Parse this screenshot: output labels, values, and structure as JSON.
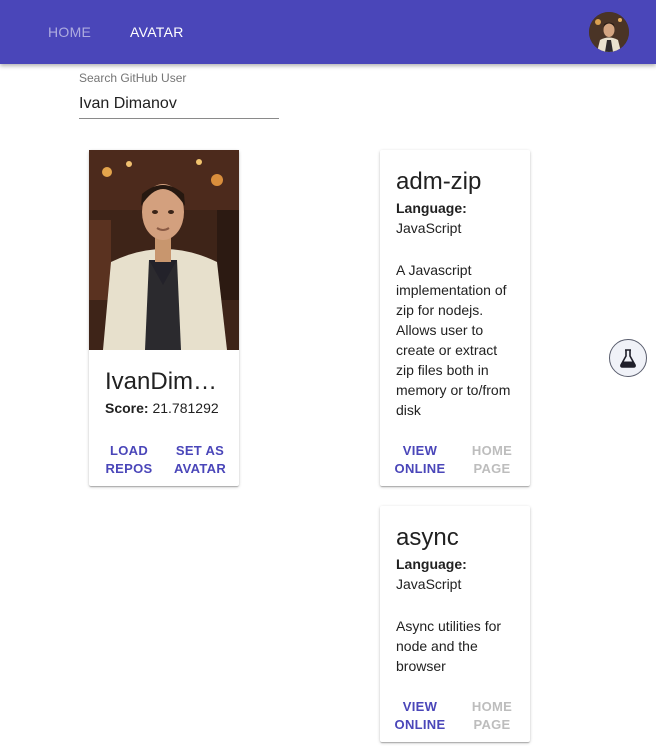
{
  "nav": {
    "tabs": [
      {
        "label": "HOME",
        "active": false
      },
      {
        "label": "AVATAR",
        "active": true
      }
    ]
  },
  "search": {
    "label": "Search GitHub User",
    "value": "Ivan Dimanov"
  },
  "user": {
    "name": "IvanDimanov",
    "score_label": "Score:",
    "score": "21.781292",
    "actions": [
      "LOAD REPOS",
      "SET AS AVATAR"
    ]
  },
  "repos": [
    {
      "name": "adm-zip",
      "language_label": "Language:",
      "language": "JavaScript",
      "description": "A Javascript implementation of zip for nodejs. Allows user to create or extract zip files both in memory or to/from disk",
      "actions": [
        {
          "label": "VIEW ONLINE",
          "enabled": true
        },
        {
          "label": "HOME PAGE",
          "enabled": false
        }
      ]
    },
    {
      "name": "async",
      "language_label": "Language:",
      "language": "JavaScript",
      "description": "Async utilities for node and the browser",
      "actions": [
        {
          "label": "VIEW ONLINE",
          "enabled": true
        },
        {
          "label": "HOME PAGE",
          "enabled": false
        }
      ]
    }
  ],
  "icons": {
    "fab": "flask-icon"
  },
  "colors": {
    "primary": "#4a46b9",
    "disabled": "#bdbdbd"
  }
}
